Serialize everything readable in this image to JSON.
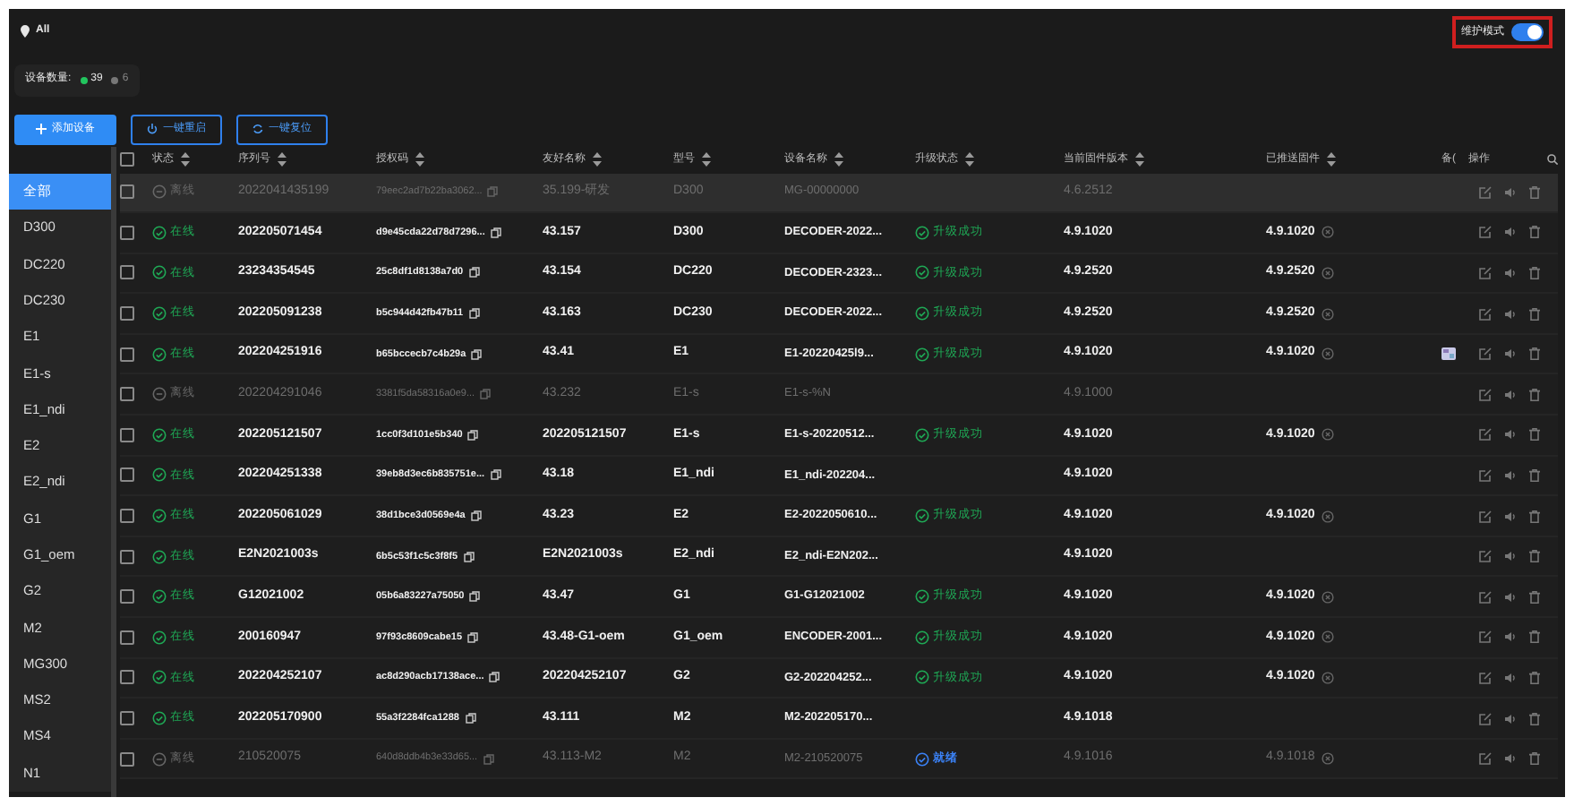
{
  "breadcrumb": "All",
  "device_count": {
    "label": "设备数量:",
    "online": "39",
    "offline": "6"
  },
  "maintenance_mode": {
    "label": "维护模式",
    "on": true
  },
  "toolbar": [
    {
      "label": "添加设备",
      "kind": "primary"
    },
    {
      "label": "一键重启",
      "kind": "restart"
    },
    {
      "label": "一键复位",
      "kind": "reset"
    }
  ],
  "sidebar": {
    "items": [
      {
        "label": "全部",
        "selected": true
      },
      {
        "label": "D300",
        "selected": false
      },
      {
        "label": "DC220",
        "selected": false
      },
      {
        "label": "DC230",
        "selected": false
      },
      {
        "label": "E1",
        "selected": false
      },
      {
        "label": "E1-s",
        "selected": false
      },
      {
        "label": "E1_ndi",
        "selected": false
      },
      {
        "label": "E2",
        "selected": false
      },
      {
        "label": "E2_ndi",
        "selected": false
      },
      {
        "label": "G1",
        "selected": false
      },
      {
        "label": "G1_oem",
        "selected": false
      },
      {
        "label": "G2",
        "selected": false
      },
      {
        "label": "M2",
        "selected": false
      },
      {
        "label": "MG300",
        "selected": false
      },
      {
        "label": "MS2",
        "selected": false
      },
      {
        "label": "MS4",
        "selected": false
      },
      {
        "label": "N1",
        "selected": false
      }
    ]
  },
  "table": {
    "select_all_checked": false,
    "columns": [
      "状态",
      "序列号",
      "授权码",
      "友好名称",
      "型号",
      "设备名称",
      "升级状态",
      "当前固件版本",
      "已推送固件",
      "备(",
      "操作"
    ],
    "rows": [
      {
        "selected": true,
        "checked": false,
        "online": false,
        "status": "离线",
        "serial": "2022041435199",
        "auth": "79eec2ad7b22ba3062...",
        "friendly": "35.199-研发",
        "model": "D300",
        "name": "MG-00000000",
        "upgrade": null,
        "current": "4.6.2512",
        "pushed": null,
        "note_icon": false
      },
      {
        "selected": false,
        "checked": false,
        "online": true,
        "status": "在线",
        "serial": "202205071454",
        "auth": "d9e45cda22d78d7296...",
        "friendly": "43.157",
        "model": "D300",
        "name": "DECODER-2022...",
        "upgrade": {
          "text": "升级成功",
          "kind": "success"
        },
        "current": "4.9.1020",
        "pushed": "4.9.1020",
        "note_icon": false
      },
      {
        "selected": false,
        "checked": false,
        "online": true,
        "status": "在线",
        "serial": "23234354545",
        "auth": "25c8df1d8138a7d0",
        "friendly": "43.154",
        "model": "DC220",
        "name": "DECODER-2323...",
        "upgrade": {
          "text": "升级成功",
          "kind": "success"
        },
        "current": "4.9.2520",
        "pushed": "4.9.2520",
        "note_icon": false
      },
      {
        "selected": false,
        "checked": false,
        "online": true,
        "status": "在线",
        "serial": "202205091238",
        "auth": "b5c944d42fb47b11",
        "friendly": "43.163",
        "model": "DC230",
        "name": "DECODER-2022...",
        "upgrade": {
          "text": "升级成功",
          "kind": "success"
        },
        "current": "4.9.2520",
        "pushed": "4.9.2520",
        "note_icon": false
      },
      {
        "selected": false,
        "checked": false,
        "online": true,
        "status": "在线",
        "serial": "202204251916",
        "auth": "b65bccecb7c4b29a",
        "friendly": "43.41",
        "model": "E1",
        "name": "E1-20220425l9...",
        "upgrade": {
          "text": "升级成功",
          "kind": "success"
        },
        "current": "4.9.1020",
        "pushed": "4.9.1020",
        "note_icon": true
      },
      {
        "selected": false,
        "checked": false,
        "online": false,
        "status": "离线",
        "serial": "202204291046",
        "auth": "3381f5da58316a0e9...",
        "friendly": "43.232",
        "model": "E1-s",
        "name": "E1-s-%N",
        "upgrade": null,
        "current": "4.9.1000",
        "pushed": null,
        "note_icon": false
      },
      {
        "selected": false,
        "checked": false,
        "online": true,
        "status": "在线",
        "serial": "202205121507",
        "auth": "1cc0f3d101e5b340",
        "friendly": "202205121507",
        "model": "E1-s",
        "name": "E1-s-20220512...",
        "upgrade": {
          "text": "升级成功",
          "kind": "success"
        },
        "current": "4.9.1020",
        "pushed": "4.9.1020",
        "note_icon": false
      },
      {
        "selected": false,
        "checked": false,
        "online": true,
        "status": "在线",
        "serial": "202204251338",
        "auth": "39eb8d3ec6b835751e...",
        "friendly": "43.18",
        "model": "E1_ndi",
        "name": "E1_ndi-202204...",
        "upgrade": null,
        "current": "4.9.1020",
        "pushed": null,
        "note_icon": false
      },
      {
        "selected": false,
        "checked": false,
        "online": true,
        "status": "在线",
        "serial": "202205061029",
        "auth": "38d1bce3d0569e4a",
        "friendly": "43.23",
        "model": "E2",
        "name": "E2-2022050610...",
        "upgrade": {
          "text": "升级成功",
          "kind": "success"
        },
        "current": "4.9.1020",
        "pushed": "4.9.1020",
        "note_icon": false
      },
      {
        "selected": false,
        "checked": false,
        "online": true,
        "status": "在线",
        "serial": "E2N2021003s",
        "auth": "6b5c53f1c5c3f8f5",
        "friendly": "E2N2021003s",
        "model": "E2_ndi",
        "name": "E2_ndi-E2N202...",
        "upgrade": null,
        "current": "4.9.1020",
        "pushed": null,
        "note_icon": false
      },
      {
        "selected": false,
        "checked": false,
        "online": true,
        "status": "在线",
        "serial": "G12021002",
        "auth": "05b6a83227a75050",
        "friendly": "43.47",
        "model": "G1",
        "name": "G1-G12021002",
        "upgrade": {
          "text": "升级成功",
          "kind": "success"
        },
        "current": "4.9.1020",
        "pushed": "4.9.1020",
        "note_icon": false
      },
      {
        "selected": false,
        "checked": false,
        "online": true,
        "status": "在线",
        "serial": "200160947",
        "auth": "97f93c8609cabe15",
        "friendly": "43.48-G1-oem",
        "model": "G1_oem",
        "name": "ENCODER-2001...",
        "upgrade": {
          "text": "升级成功",
          "kind": "success"
        },
        "current": "4.9.1020",
        "pushed": "4.9.1020",
        "note_icon": false
      },
      {
        "selected": false,
        "checked": false,
        "online": true,
        "status": "在线",
        "serial": "202204252107",
        "auth": "ac8d290acb17138ace...",
        "friendly": "202204252107",
        "model": "G2",
        "name": "G2-202204252...",
        "upgrade": {
          "text": "升级成功",
          "kind": "success"
        },
        "current": "4.9.1020",
        "pushed": "4.9.1020",
        "note_icon": false
      },
      {
        "selected": false,
        "checked": false,
        "online": true,
        "status": "在线",
        "serial": "202205170900",
        "auth": "55a3f2284fca1288",
        "friendly": "43.111",
        "model": "M2",
        "name": "M2-202205170...",
        "upgrade": null,
        "current": "4.9.1018",
        "pushed": null,
        "note_icon": false
      },
      {
        "selected": false,
        "checked": false,
        "online": false,
        "status": "离线",
        "serial": "210520075",
        "auth": "640d8ddb4b3e33d65...",
        "friendly": "43.113-M2",
        "model": "M2",
        "name": "M2-210520075",
        "upgrade": {
          "text": "就绪",
          "kind": "ready"
        },
        "current": "4.9.1016",
        "pushed": "4.9.1018",
        "note_icon": false
      }
    ]
  }
}
